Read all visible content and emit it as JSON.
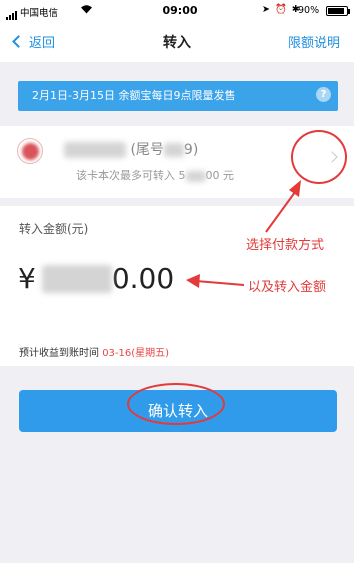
{
  "status_bar": {
    "carrier": "中国电信",
    "time": "09:00",
    "battery": "90%",
    "battery_level": 0.9
  },
  "nav": {
    "back_label": "返回",
    "title": "转入",
    "limit_label": "限额说明"
  },
  "banner": {
    "text": "2月1日-3月15日  余额宝每日9点限量发售",
    "help_symbol": "?"
  },
  "card": {
    "name_suffix": "(尾号",
    "name_end": "9)",
    "limit_prefix": "该卡本次最多可转入 5",
    "limit_suffix": "00 元"
  },
  "amount": {
    "label": "转入金额(元)",
    "currency": "¥",
    "value_suffix": "0.00"
  },
  "estimate": {
    "label": "预计收益到账时间 ",
    "date": "03-16(星期五)"
  },
  "confirm": {
    "label": "确认转入"
  },
  "annotations": {
    "choose_payment": "选择付款方式",
    "and_amount": "以及转入金额"
  },
  "colors": {
    "accent": "#1e8fe1",
    "banner": "#3ba3ea",
    "button": "#2f9bea",
    "annotation": "#e33a3a",
    "date": "#e94444"
  }
}
